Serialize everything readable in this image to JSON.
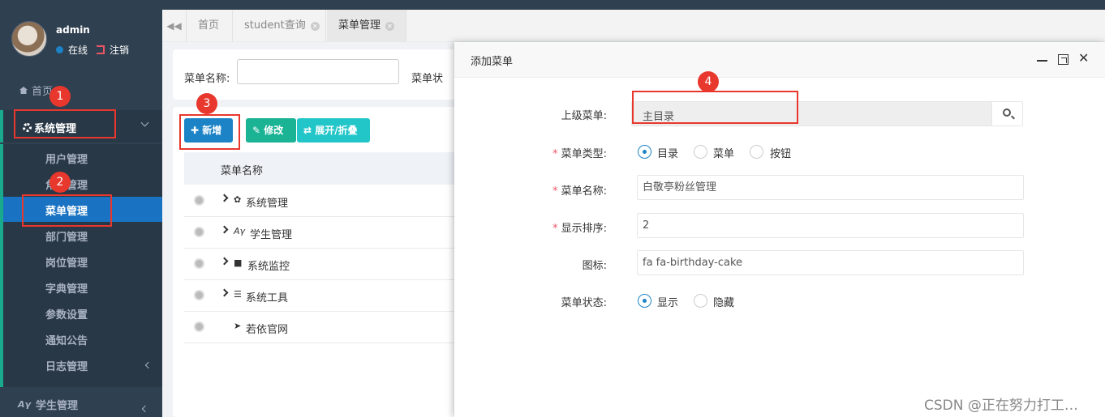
{
  "user": {
    "name": "admin",
    "online": "在线",
    "logout": "注销"
  },
  "sidebar": {
    "home": "首页",
    "system": "系统管理",
    "submenu": [
      "用户管理",
      "角色管理",
      "菜单管理",
      "部门管理",
      "岗位管理",
      "字典管理",
      "参数设置",
      "通知公告",
      "日志管理"
    ],
    "student": "学生管理",
    "active_item": "菜单管理",
    "accent_color": "#1a73c2"
  },
  "tabs": [
    "首页",
    "student查询",
    "菜单管理"
  ],
  "search": {
    "name_label": "菜单名称:",
    "status_label": "菜单状"
  },
  "toolbar": {
    "add": "新增",
    "edit": "修改",
    "toggle": "展开/折叠"
  },
  "table": {
    "header": "菜单名称",
    "rows": [
      {
        "icon": "gear-icon",
        "label": "系统管理"
      },
      {
        "icon": "student-icon",
        "label": "学生管理"
      },
      {
        "icon": "video-icon",
        "label": "系统监控"
      },
      {
        "icon": "bars-icon",
        "label": "系统工具"
      },
      {
        "icon": "location-arrow-icon",
        "label": "若依官网"
      }
    ]
  },
  "modal": {
    "title": "添加菜单",
    "parent_label": "上级菜单:",
    "parent_value": "主目录",
    "type_label": "菜单类型:",
    "type_options": [
      "目录",
      "菜单",
      "按钮"
    ],
    "type_selected": "目录",
    "name_label": "菜单名称:",
    "name_value": "白敬亭粉丝管理",
    "order_label": "显示排序:",
    "order_value": "2",
    "icon_label": "图标:",
    "icon_value": "fa fa-birthday-cake",
    "status_label": "菜单状态:",
    "status_options": [
      "显示",
      "隐藏"
    ],
    "status_selected": "显示"
  },
  "annotations": [
    "1",
    "2",
    "3",
    "4"
  ],
  "watermark": "CSDN @正在努力打工…"
}
